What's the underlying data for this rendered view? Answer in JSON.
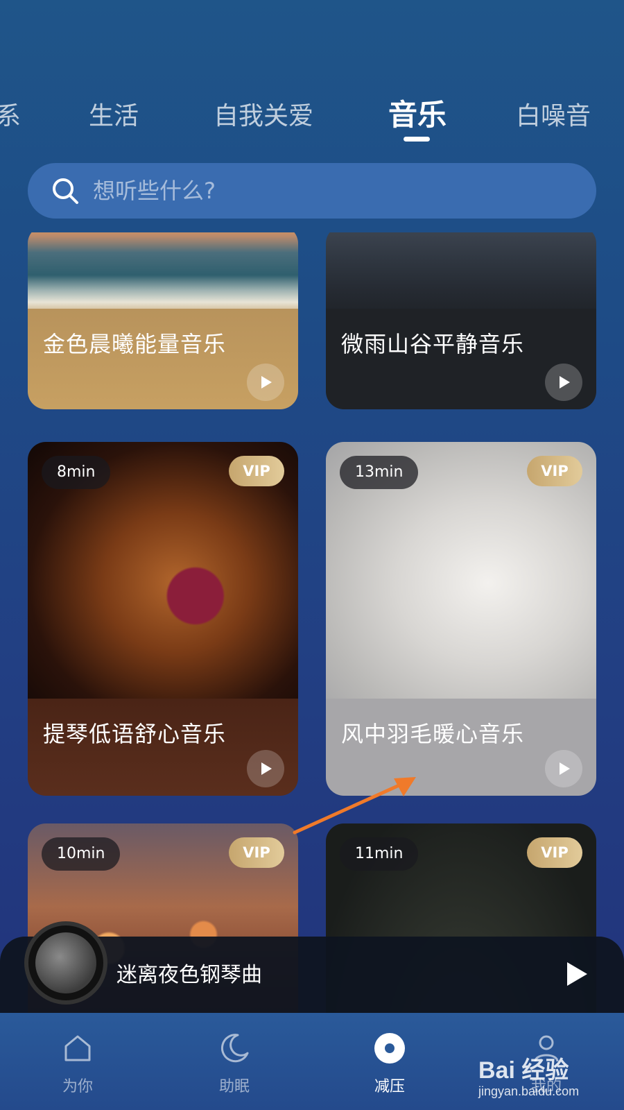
{
  "tabs": [
    {
      "label": "系"
    },
    {
      "label": "生活"
    },
    {
      "label": "自我关爱"
    },
    {
      "label": "音乐",
      "active": true
    },
    {
      "label": "白噪音"
    }
  ],
  "search": {
    "placeholder": "想听些什么?"
  },
  "cards": [
    {
      "title": "金色晨曦能量音乐",
      "duration": "",
      "vip": ""
    },
    {
      "title": "微雨山谷平静音乐",
      "duration": "",
      "vip": ""
    },
    {
      "title": "提琴低语舒心音乐",
      "duration": "8min",
      "vip": "VIP"
    },
    {
      "title": "风中羽毛暖心音乐",
      "duration": "13min",
      "vip": "VIP"
    },
    {
      "title": "",
      "duration": "10min",
      "vip": "VIP"
    },
    {
      "title": "",
      "duration": "11min",
      "vip": "VIP"
    }
  ],
  "player": {
    "title": "迷离夜色钢琴曲"
  },
  "nav": [
    {
      "label": "为你",
      "icon": "home-icon"
    },
    {
      "label": "助眠",
      "icon": "moon-icon"
    },
    {
      "label": "减压",
      "icon": "disc-icon",
      "active": true
    },
    {
      "label": "我的",
      "icon": "profile-icon"
    }
  ],
  "watermark": {
    "logo": "Bai 经验",
    "url": "jingyan.baidu.com"
  }
}
